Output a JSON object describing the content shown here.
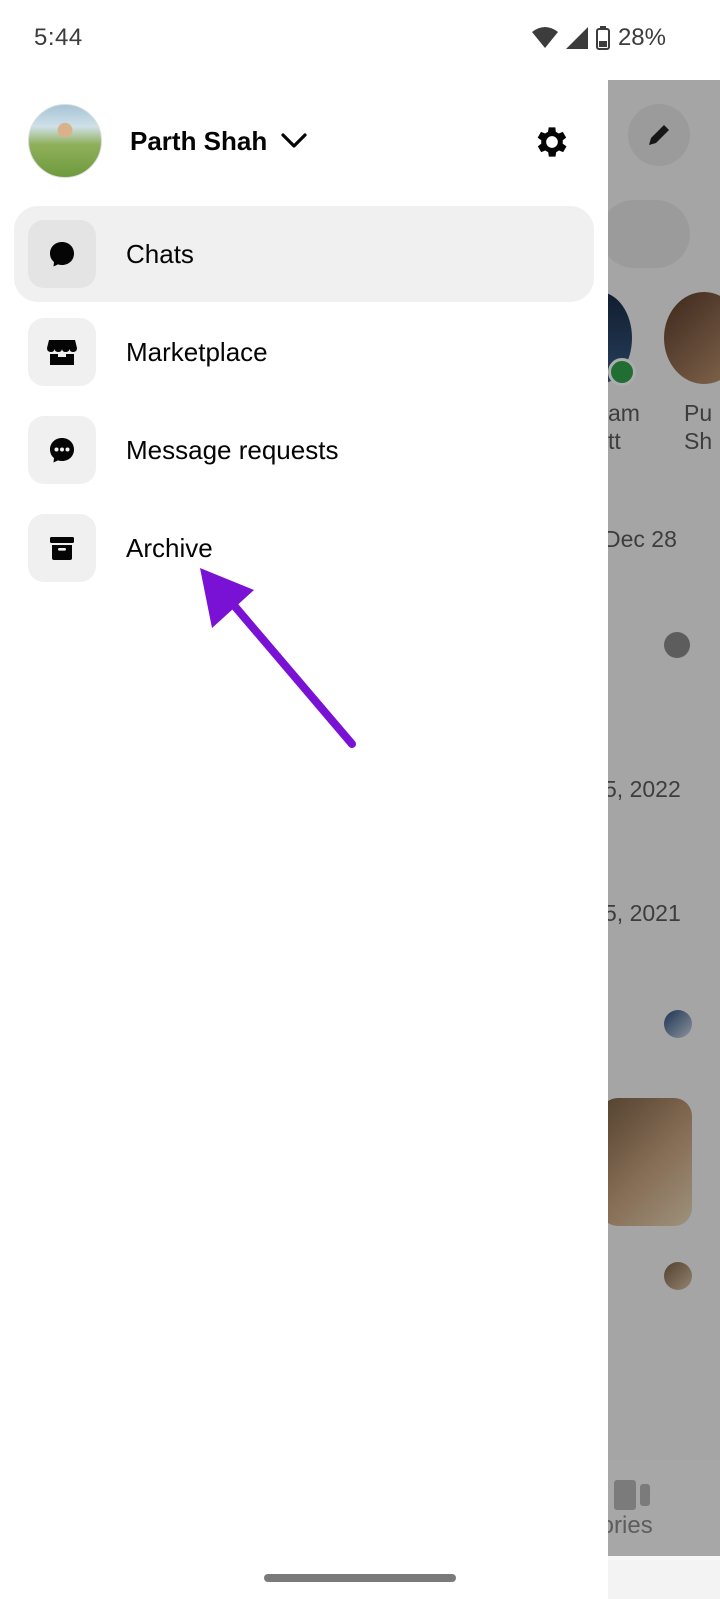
{
  "status_bar": {
    "time": "5:44",
    "battery": "28%"
  },
  "profile": {
    "name": "Parth Shah"
  },
  "menu": {
    "items": [
      {
        "label": "Chats",
        "icon": "chat-bubble-icon",
        "active": true
      },
      {
        "label": "Marketplace",
        "icon": "storefront-icon",
        "active": false
      },
      {
        "label": "Message requests",
        "icon": "message-requests-icon",
        "active": false
      },
      {
        "label": "Archive",
        "icon": "archive-box-icon",
        "active": false
      }
    ]
  },
  "background": {
    "story_names": [
      "am",
      "tt",
      "Pu",
      "Sh"
    ],
    "dates": [
      "Dec 28",
      "5, 2022",
      "5, 2021"
    ],
    "nav_label": "tories"
  },
  "colors": {
    "annotation_arrow": "#7a12d6",
    "scrim": "rgba(0,0,0,0.32)"
  }
}
